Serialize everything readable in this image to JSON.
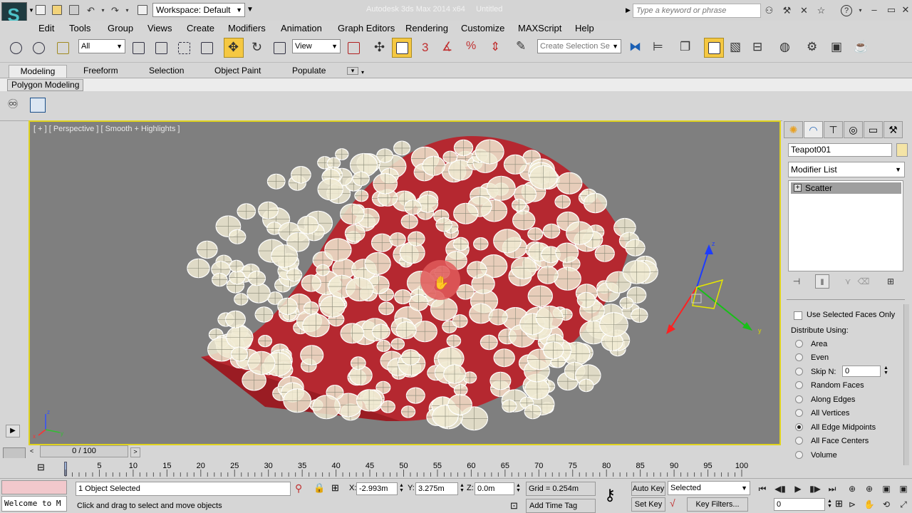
{
  "app": {
    "title": "Autodesk 3ds Max 2014 x64",
    "document": "Untitled",
    "workspace": "Workspace: Default",
    "search_placeholder": "Type a keyword or phrase"
  },
  "menu": [
    "Edit",
    "Tools",
    "Group",
    "Views",
    "Create",
    "Modifiers",
    "Animation",
    "Graph Editors",
    "Rendering",
    "Customize",
    "MAXScript",
    "Help"
  ],
  "toolbar": {
    "selection_filter": "All",
    "reference_coord": "View",
    "named_selection_placeholder": "Create Selection Se"
  },
  "ribbon": {
    "tabs": [
      "Modeling",
      "Freeform",
      "Selection",
      "Object Paint",
      "Populate"
    ],
    "active_tab": "Modeling",
    "subtab": "Polygon Modeling"
  },
  "viewport": {
    "label": "[ + ] [ Perspective ] [ Smooth + Highlights ]",
    "axis_x": "x",
    "axis_y": "y",
    "axis_z": "z"
  },
  "command_panel": {
    "object_name": "Teapot001",
    "object_color": "#f4e4a6",
    "modifier_list": "Modifier List",
    "stack_item": "Scatter",
    "use_selected_faces": "Use Selected Faces Only",
    "distribute_label": "Distribute Using:",
    "options": [
      "Area",
      "Even",
      "Skip N:",
      "Random Faces",
      "Along Edges",
      "All Vertices",
      "All Edge Midpoints",
      "All Face Centers",
      "Volume"
    ],
    "selected_option": "All Edge Midpoints",
    "skip_n_value": "0"
  },
  "timeline": {
    "frame_display": "0 / 100",
    "ticks": [
      "0",
      "5",
      "10",
      "15",
      "20",
      "25",
      "30",
      "35",
      "40",
      "45",
      "50",
      "55",
      "60",
      "65",
      "70",
      "75",
      "80",
      "85",
      "90",
      "95",
      "100"
    ]
  },
  "status": {
    "welcome": "Welcome to M",
    "selection": "1 Object Selected",
    "prompt": "Click and drag to select and move objects",
    "x_label": "X:",
    "x_value": "-2.993m",
    "y_label": "Y:",
    "y_value": "3.275m",
    "z_label": "Z:",
    "z_value": "0.0m",
    "grid": "Grid = 0.254m",
    "add_time_tag": "Add Time Tag",
    "auto_key": "Auto Key",
    "set_key": "Set Key",
    "key_mode": "Selected",
    "key_filters": "Key Filters...",
    "frame": "0"
  },
  "colors": {
    "viewport_bg": "#7f7f7f",
    "viewport_border": "#e0d31d",
    "accent": "#f5c842",
    "teapot_red": "#b8242c",
    "wire_cream": "#f0ead2"
  }
}
